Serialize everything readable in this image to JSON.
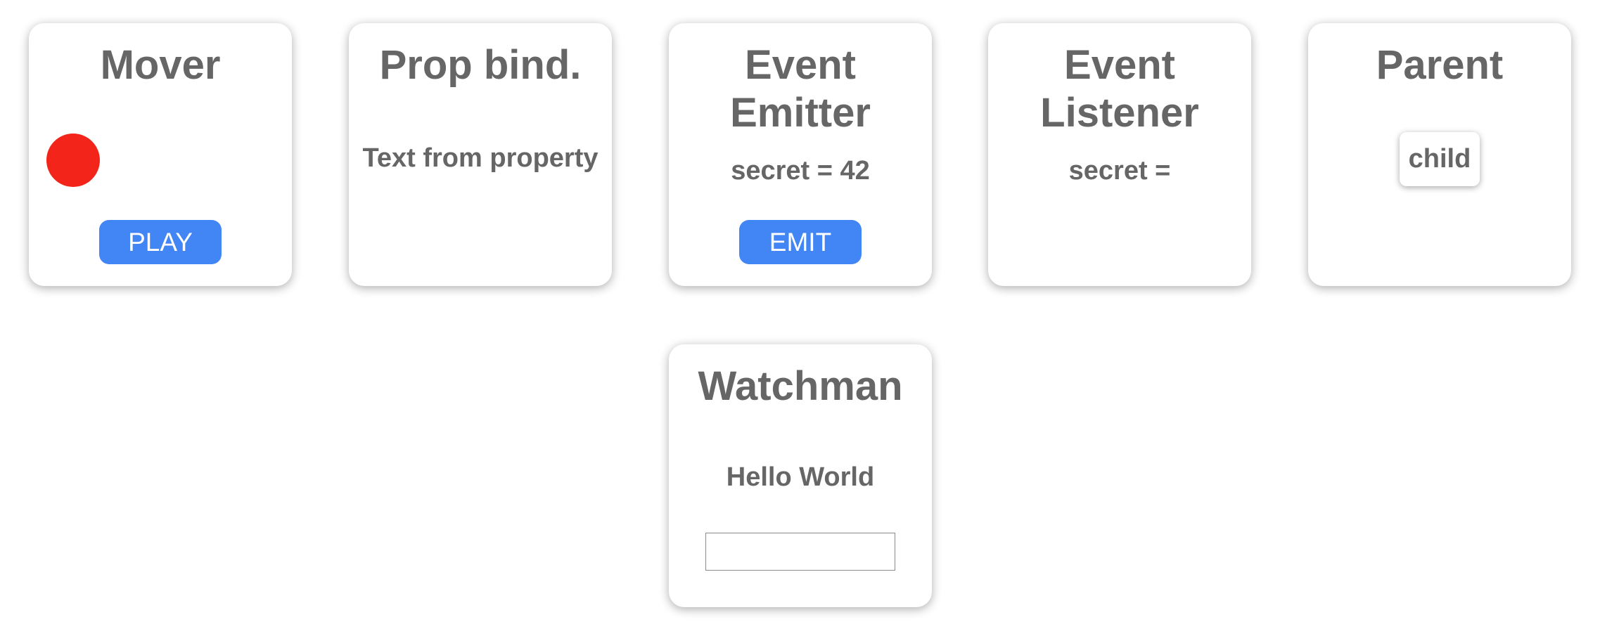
{
  "cards": {
    "mover": {
      "title": "Mover",
      "button_label": "PLAY",
      "dot_color": "#f3251a"
    },
    "prop_binding": {
      "title": "Prop bind.",
      "text": "Text from property"
    },
    "event_emitter": {
      "title_line1": "Event",
      "title_line2": "Emitter",
      "text": "secret = 42",
      "button_label": "EMIT"
    },
    "event_listener": {
      "title_line1": "Event",
      "title_line2": "Listener",
      "text": "secret ="
    },
    "parent": {
      "title": "Parent",
      "child_label": "child"
    },
    "watchman": {
      "title": "Watchman",
      "text": "Hello World",
      "input_value": "",
      "input_placeholder": ""
    }
  },
  "colors": {
    "accent": "#4285f4",
    "text": "#666666",
    "dot": "#f3251a"
  }
}
